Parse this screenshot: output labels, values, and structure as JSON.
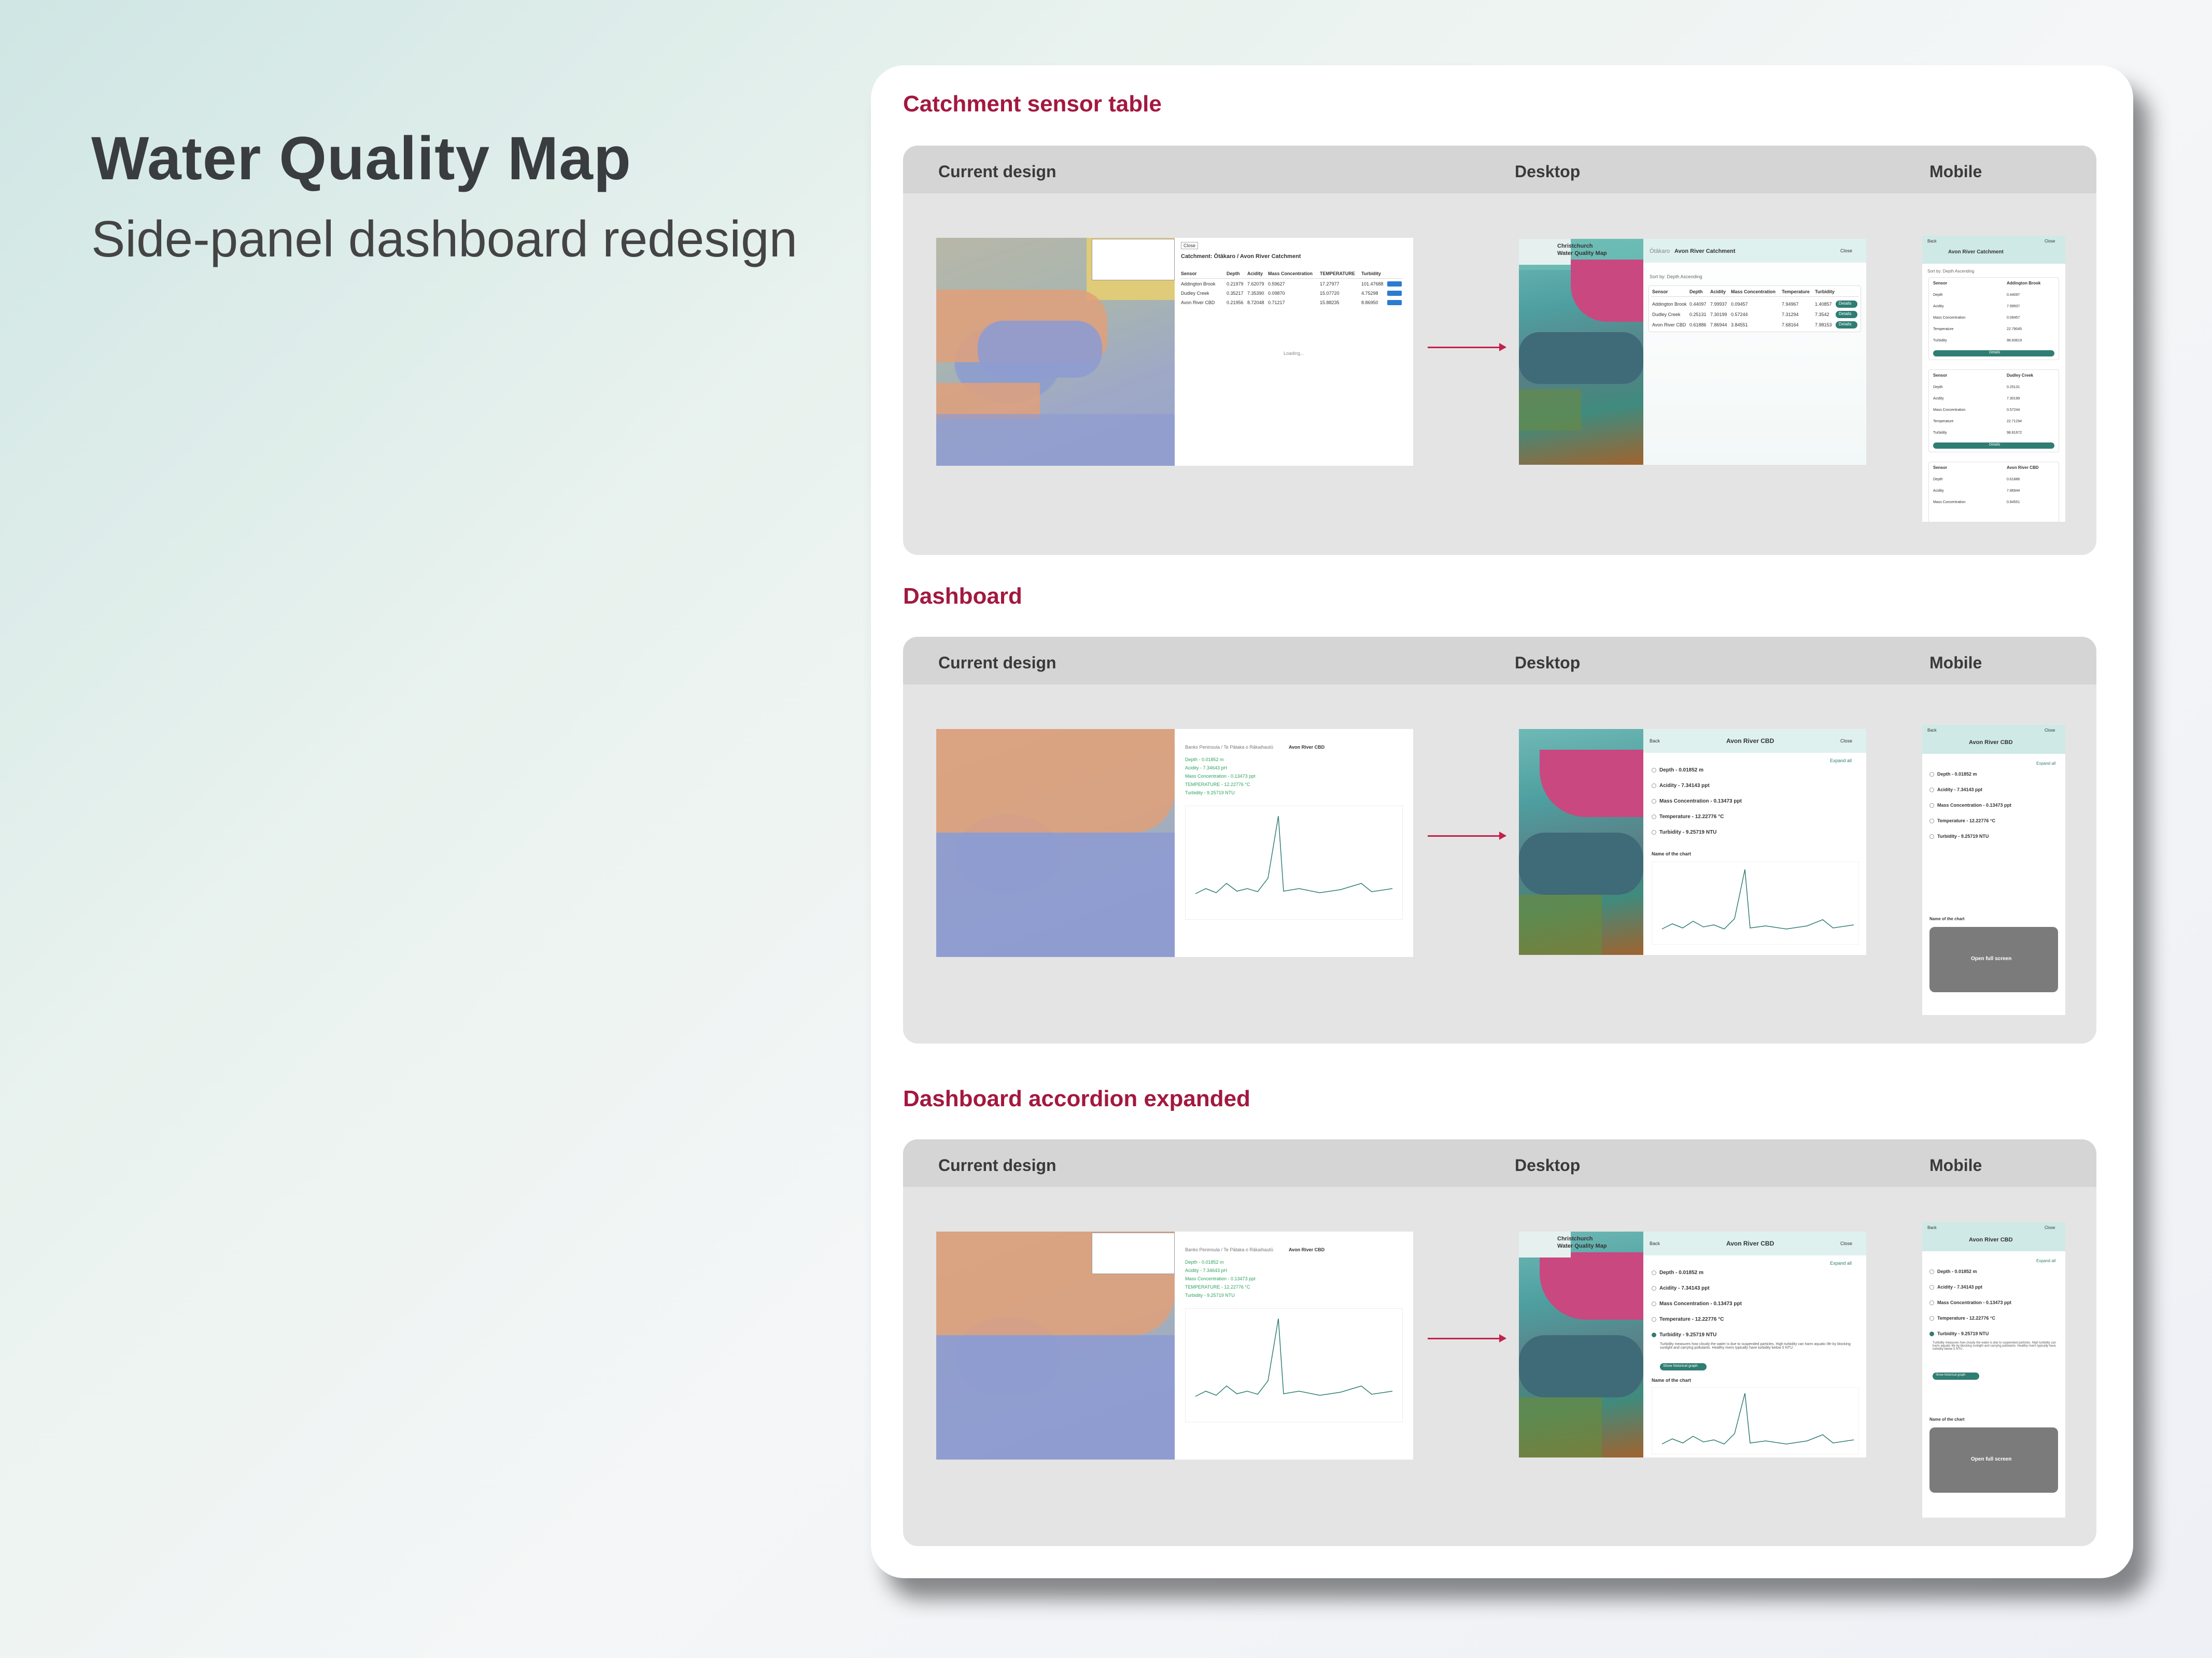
{
  "hero": {
    "title": "Water Quality Map",
    "subtitle": "Side-panel dashboard redesign"
  },
  "columns": {
    "current": "Current design",
    "desktop": "Desktop",
    "mobile": "Mobile"
  },
  "sections": [
    {
      "heading": "Catchment sensor table"
    },
    {
      "heading": "Dashboard"
    },
    {
      "heading": "Dashboard accordion expanded"
    }
  ],
  "shot1": {
    "current_title": "Catchment: Ōtākaro / Avon River Catchment",
    "current_headers": [
      "Sensor",
      "Depth",
      "Acidity",
      "Mass Concentration",
      "TEMPERATURE",
      "Turbidity"
    ],
    "current_rows": [
      [
        "Addington Brook",
        "0.21979",
        "7.62079",
        "0.59627",
        "17.27977",
        "101.47688"
      ],
      [
        "Dudley Creek",
        "0.35217",
        "7.35390",
        "0.09870",
        "15.07720",
        "4.75298"
      ],
      [
        "Avon River CBD",
        "0.21956",
        "8.72048",
        "0.71217",
        "15.88235",
        "8.86950"
      ]
    ],
    "close_label": "Close",
    "loading_label": "Loading...",
    "desktop_brand_line1": "Christchurch",
    "desktop_brand_line2": "Water Quality Map",
    "desktop_title_prefix": "Ōtākaro",
    "desktop_title": "Avon River Catchment",
    "desktop_close": "Close",
    "desktop_sort": "Sort by: Depth Ascending",
    "desktop_headers": [
      "Sensor",
      "Depth",
      "Acidity",
      "Mass Concentration",
      "Temperature",
      "Turbidity"
    ],
    "desktop_rows": [
      [
        "Addington Brook",
        "0.44097",
        "7.99937",
        "0.09457",
        "7.94967",
        "1.40857"
      ],
      [
        "Dudley Creek",
        "0.25131",
        "7.30199",
        "0.57244",
        "7.31294",
        "7.3542"
      ],
      [
        "Avon River CBD",
        "0.61886",
        "7.86944",
        "3.84551",
        "7.68164",
        "7.98153"
      ]
    ],
    "details_label": "Details",
    "mobile_back": "Back",
    "mobile_close": "Close",
    "mobile_title": "Avon River Catchment",
    "mobile_sort": "Sort by: Depth Ascending",
    "mobile_cards": [
      {
        "sensor": "Addington Brook",
        "rows": [
          [
            "Depth",
            "0.44097"
          ],
          [
            "Acidity",
            "7.99937"
          ],
          [
            "Mass Concentration",
            "0.09457"
          ],
          [
            "Temperature",
            "22.79045"
          ],
          [
            "Turbidity",
            "98.83619"
          ]
        ]
      },
      {
        "sensor": "Dudley Creek",
        "rows": [
          [
            "Depth",
            "0.25131"
          ],
          [
            "Acidity",
            "7.30199"
          ],
          [
            "Mass Concentration",
            "0.57244"
          ],
          [
            "Temperature",
            "22.71294"
          ],
          [
            "Turbidity",
            "98.81672"
          ]
        ]
      },
      {
        "sensor": "Avon River CBD",
        "rows": [
          [
            "Depth",
            "0.61886"
          ],
          [
            "Acidity",
            "7.86944"
          ],
          [
            "Mass Concentration",
            "0.84551"
          ]
        ]
      }
    ],
    "sensor_label": "Sensor"
  },
  "shot2": {
    "current_crumb": "Banks Peninsula / Te Pātaka o Rākaihautū",
    "current_title": "Avon River CBD",
    "current_items": [
      "Depth - 0.01852 m",
      "Acidity - 7.34643 pH",
      "Mass Concentration - 0.13473 ppt",
      "TEMPERATURE - 12.22776 °C",
      "Turbidity - 9.25719 NTU"
    ],
    "desktop_back": "Back",
    "desktop_title": "Avon River CBD",
    "desktop_close": "Close",
    "expand_all": "Expand all",
    "accordion": [
      "Depth - 0.01852 m",
      "Acidity - 7.34143 ppt",
      "Mass Concentration - 0.13473 ppt",
      "Temperature - 12.22776 °C",
      "Turbidity - 9.25719 NTU"
    ],
    "chart_name": "Name of the chart",
    "open_full_screen": "Open full screen"
  },
  "shot3": {
    "turbidity_text": "Turbidity measures how cloudy the water is due to suspended particles. High turbidity can harm aquatic life by blocking sunlight and carrying pollutants. Healthy rivers typically have turbidity below 5 NTU.",
    "show_historical": "Show historical graph"
  }
}
